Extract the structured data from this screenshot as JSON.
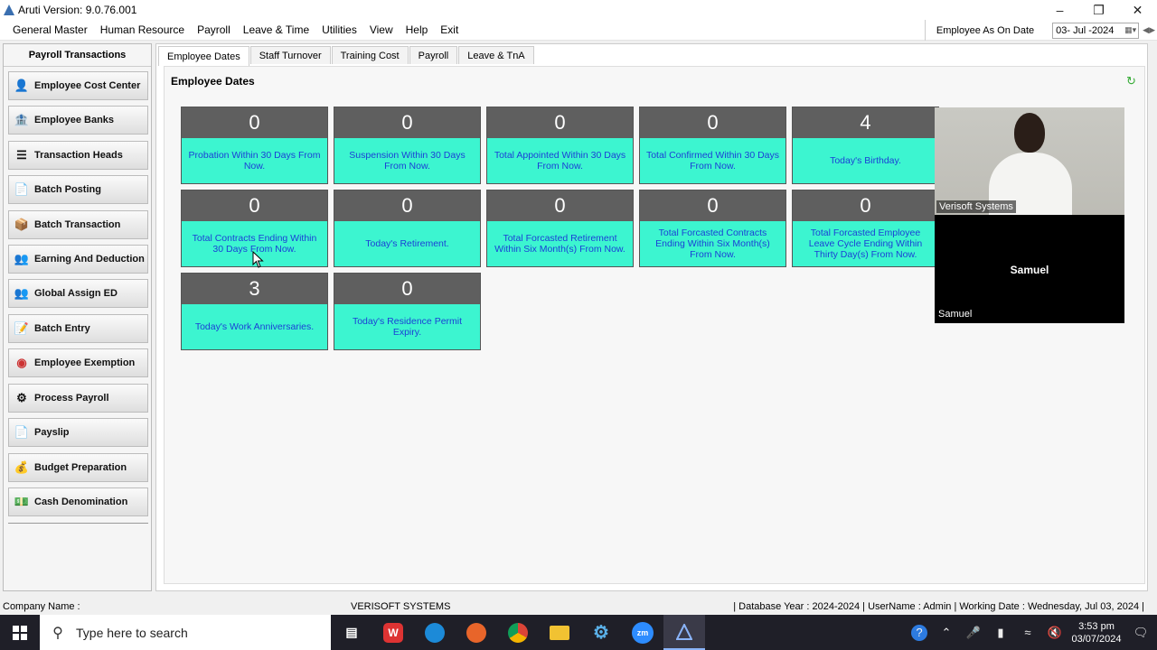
{
  "window": {
    "title": "Aruti Version: 9.0.76.001"
  },
  "menu": [
    "General Master",
    "Human Resource",
    "Payroll",
    "Leave & Time",
    "Utilities",
    "View",
    "Help",
    "Exit"
  ],
  "as_of": {
    "label": "Employee As On Date",
    "date": "03- Jul -2024"
  },
  "sidebar": {
    "title": "Payroll Transactions",
    "items": [
      {
        "label": "Employee Cost Center",
        "icon": "cost-center-icon"
      },
      {
        "label": "Employee Banks",
        "icon": "bank-icon"
      },
      {
        "label": "Transaction Heads",
        "icon": "transaction-heads-icon"
      },
      {
        "label": "Batch Posting",
        "icon": "batch-posting-icon"
      },
      {
        "label": "Batch Transaction",
        "icon": "batch-transaction-icon"
      },
      {
        "label": "Earning And Deduction",
        "icon": "earning-deduction-icon"
      },
      {
        "label": "Global Assign ED",
        "icon": "global-assign-icon"
      },
      {
        "label": "Batch Entry",
        "icon": "batch-entry-icon"
      },
      {
        "label": "Employee Exemption",
        "icon": "exemption-icon"
      },
      {
        "label": "Process Payroll",
        "icon": "process-payroll-icon"
      },
      {
        "label": "Payslip",
        "icon": "payslip-icon"
      },
      {
        "label": "Budget Preparation",
        "icon": "budget-icon"
      },
      {
        "label": "Cash Denomination",
        "icon": "cash-icon"
      }
    ]
  },
  "tabs": [
    "Employee Dates",
    "Staff Turnover",
    "Training Cost",
    "Payroll",
    "Leave & TnA"
  ],
  "section_title": "Employee Dates",
  "tiles": [
    {
      "count": "0",
      "label": "Probation Within 30 Days From Now."
    },
    {
      "count": "0",
      "label": "Suspension Within 30 Days From Now."
    },
    {
      "count": "0",
      "label": "Total Appointed Within 30 Days From Now."
    },
    {
      "count": "0",
      "label": "Total Confirmed Within 30 Days From Now."
    },
    {
      "count": "4",
      "label": "Today's Birthday."
    },
    {
      "count": "0",
      "label": "Total Contracts Ending Within 30 Days From Now."
    },
    {
      "count": "0",
      "label": "Today's Retirement."
    },
    {
      "count": "0",
      "label": "Total Forcasted Retirement Within  Six Month(s) From Now."
    },
    {
      "count": "0",
      "label": "Total Forcasted Contracts Ending Within  Six Month(s) From Now."
    },
    {
      "count": "0",
      "label": "Total Forcasted Employee Leave Cycle Ending Within  Thirty Day(s) From Now."
    },
    {
      "count": "3",
      "label": "Today's Work Anniversaries."
    },
    {
      "count": "0",
      "label": "Today's Residence Permit Expiry."
    }
  ],
  "video": {
    "top_label": "Verisoft Systems",
    "center_name": "Samuel",
    "bottom_label": "Samuel"
  },
  "status": {
    "company_label": "Company Name :",
    "company": "VERISOFT SYSTEMS",
    "right": "|  Database Year :  2024-2024  |  UserName :  Admin  |  Working Date :  Wednesday, Jul 03, 2024  |"
  },
  "taskbar": {
    "search_placeholder": "Type here to search",
    "time": "3:53 pm",
    "date": "03/07/2024"
  },
  "colors": {
    "tile_top": "#5f5f5f",
    "tile_bottom": "#3cf5d0",
    "tile_text": "#1b3fd6"
  }
}
